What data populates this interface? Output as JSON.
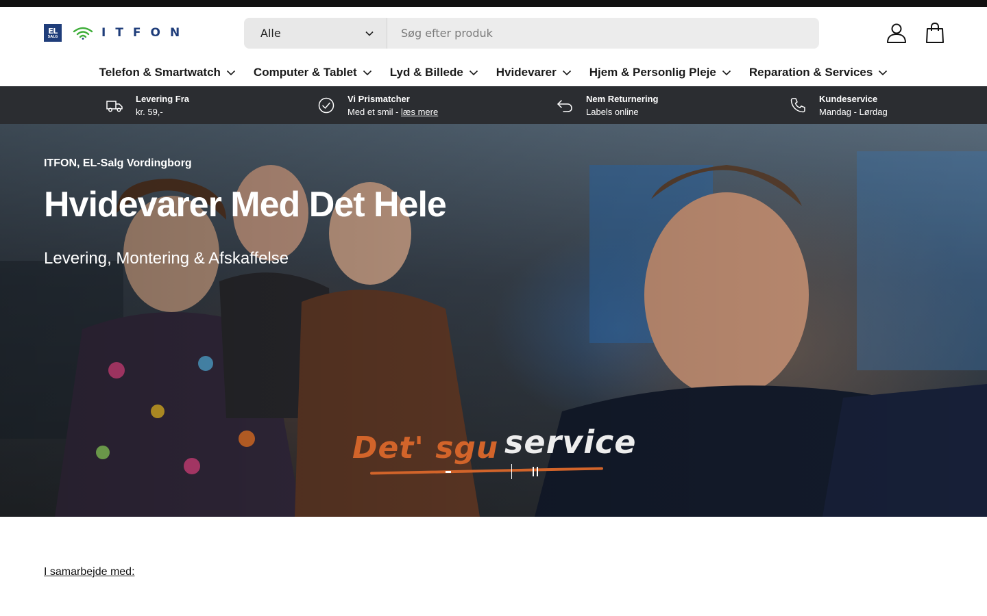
{
  "header": {
    "logo": {
      "badge_top": "EL",
      "badge_bottom": "SALG",
      "wordmark": "ITFON"
    },
    "search": {
      "category_selected": "Alle",
      "placeholder": "Søg efter produk"
    },
    "icons": {
      "account": "user-icon",
      "cart": "shopping-bag-icon"
    }
  },
  "nav": {
    "items": [
      {
        "label": "Telefon & Smartwatch"
      },
      {
        "label": "Computer & Tablet"
      },
      {
        "label": "Lyd & Billede"
      },
      {
        "label": "Hvidevarer"
      },
      {
        "label": "Hjem & Personlig Pleje"
      },
      {
        "label": "Reparation & Services"
      }
    ]
  },
  "usp": {
    "items": [
      {
        "icon": "truck-icon",
        "title": "Levering Fra",
        "text": "kr. 59,-"
      },
      {
        "icon": "check-circle-icon",
        "title": "Vi Prismatcher",
        "text_prefix": "Med et smil - ",
        "link": "læs mere"
      },
      {
        "icon": "return-arrow-icon",
        "title": "Nem Returnering",
        "text": "Labels online"
      },
      {
        "icon": "phone-icon",
        "title": "Kundeservice",
        "text": "Mandag - Lørdag"
      }
    ]
  },
  "hero": {
    "eyebrow": "ITFON, EL-Salg Vordingborg",
    "title": "Hvidevarer Med Det Hele",
    "subtitle": "Levering, Montering & Afskaffelse",
    "slogan_part1": "Det' sgu",
    "slogan_part2": "service",
    "slides": {
      "count": 2,
      "active": 1
    }
  },
  "partner": {
    "label": "I samarbejde med:"
  },
  "colors": {
    "brand_blue": "#1f3d7a",
    "wifi_green": "#3fae3a",
    "usp_bar": "#2b2d31",
    "slogan_orange": "#d2642a"
  }
}
